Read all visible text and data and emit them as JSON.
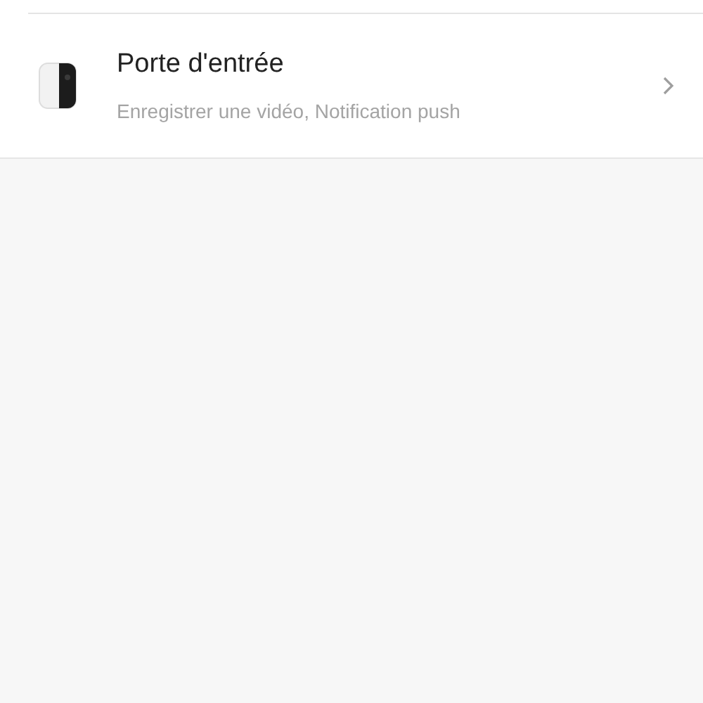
{
  "devices": [
    {
      "name": "Porte d'entrée",
      "subtitle": "Enregistrer une vidéo, Notification push"
    }
  ]
}
